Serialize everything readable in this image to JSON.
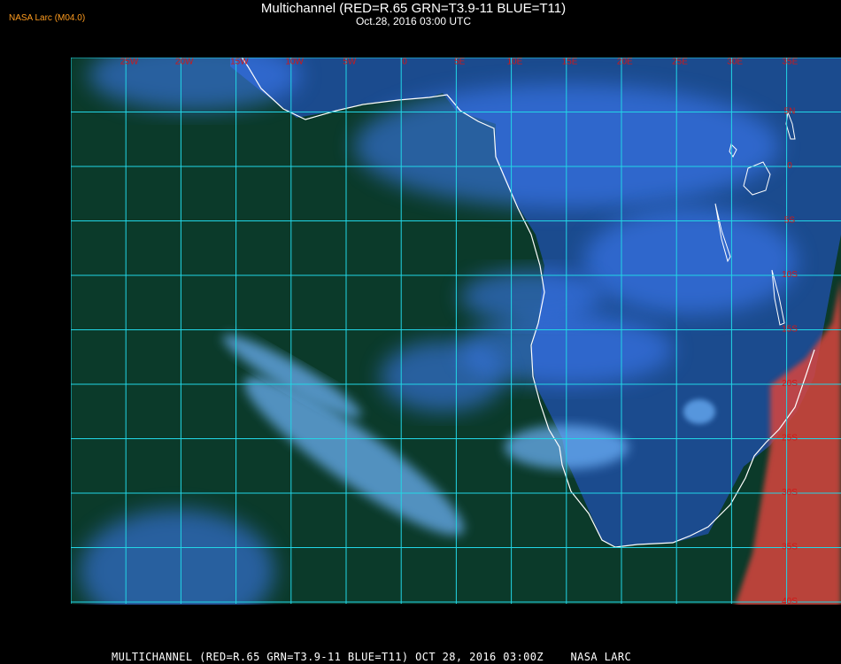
{
  "header": {
    "badge": "NASA Larc (M04.0)",
    "title": "Multichannel (RED=R.65 GRN=T3.9-11 BLUE=T11)",
    "subtitle": "Oct.28, 2016 03:00 UTC"
  },
  "footer": {
    "caption": "MULTICHANNEL (RED=R.65 GRN=T3.9-11 BLUE=T11) OCT 28, 2016 03:00Z    NASA LARC"
  },
  "map": {
    "colors": {
      "background": "#000000",
      "ocean": "#0b3a2a",
      "land": "#1e4fa0",
      "cloud": "#6fb6ff",
      "cloud_dense": "#3f7fff",
      "desert": "#d8443c",
      "grid": "#22d6e6",
      "coast": "#ffffff",
      "labels": "#d01818"
    },
    "longitude_labels": [
      "25W",
      "20W",
      "15W",
      "10W",
      "5W",
      "0",
      "5E",
      "10E",
      "15E",
      "20E",
      "25E",
      "30E",
      "35E"
    ],
    "latitude_labels": [
      "5N",
      "0",
      "5S",
      "10S",
      "15S",
      "20S",
      "25S",
      "30S",
      "35S",
      "40S"
    ]
  }
}
